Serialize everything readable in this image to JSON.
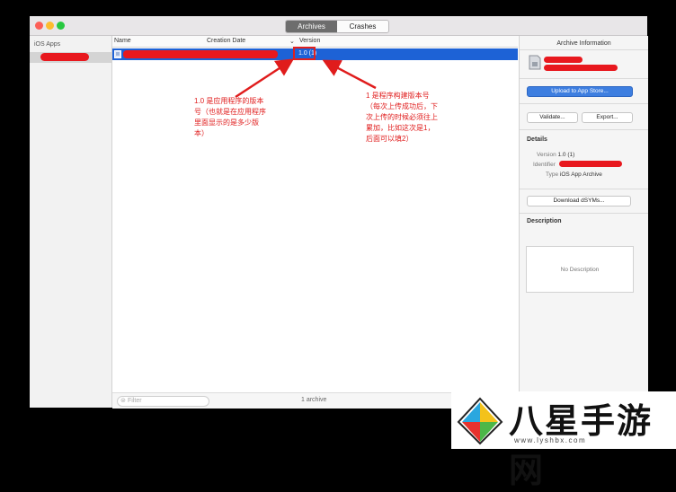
{
  "toolbar": {
    "tab_archives": "Archives",
    "tab_crashes": "Crashes",
    "traffic_colors": [
      "#fc5f57",
      "#fdbc2e",
      "#28c840"
    ]
  },
  "sidebar": {
    "section_title": "iOS Apps"
  },
  "table": {
    "headers": {
      "name": "Name",
      "creation_date": "Creation Date",
      "version": "Version"
    },
    "selected_row": {
      "version": "1.0 (1)"
    }
  },
  "footer": {
    "filter_placeholder": "Filter",
    "count": "1 archive"
  },
  "inspector": {
    "title": "Archive Information",
    "upload_button": "Upload to App Store...",
    "validate_button": "Validate...",
    "export_button": "Export...",
    "details_title": "Details",
    "version_key": "Version",
    "version_value": "1.0 (1)",
    "identifier_key": "Identifier",
    "type_key": "Type",
    "type_value": "iOS App Archive",
    "download_button": "Download dSYMs...",
    "description_title": "Description",
    "description_placeholder": "No Description"
  },
  "annotations": {
    "left": [
      "1.0 是应用程序的版本",
      "号（也就是在应用程序",
      "里面显示的是多少版",
      "本）"
    ],
    "right": [
      "1 是程序构建版本号",
      "（每次上传成功后，下",
      "次上传的时候必须往上",
      "累加，比如这次是1，",
      "后面可以填2）"
    ]
  },
  "watermark": {
    "name": "八星手游网",
    "url": "www.lyshbx.com"
  },
  "colors": {
    "selection": "#1d62d6",
    "annotation_red": "#e01c1c",
    "primary_button": "#3d7ee0"
  }
}
